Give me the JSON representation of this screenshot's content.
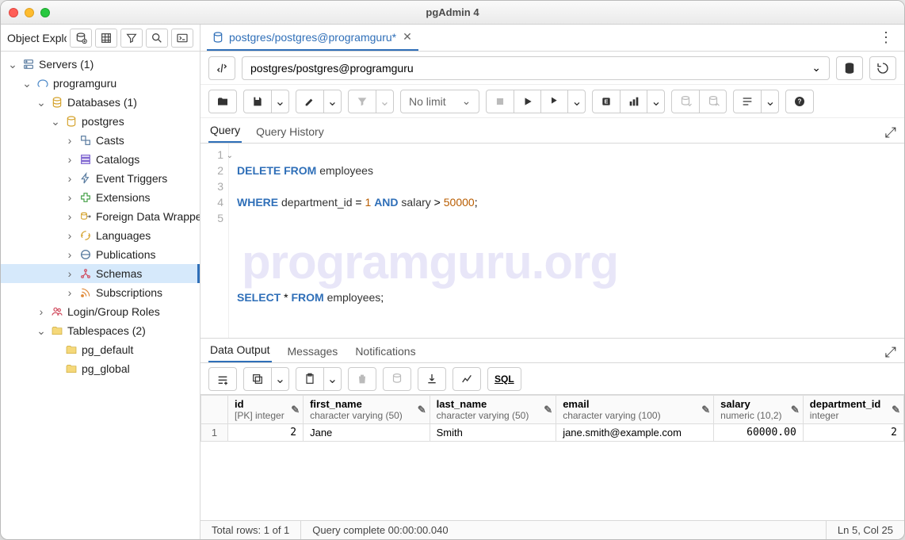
{
  "window": {
    "title": "pgAdmin 4"
  },
  "sidebar": {
    "header": "Object Explorer",
    "tree": {
      "servers": "Servers (1)",
      "server_name": "programguru",
      "databases": "Databases (1)",
      "db_name": "postgres",
      "casts": "Casts",
      "catalogs": "Catalogs",
      "event_triggers": "Event Triggers",
      "extensions": "Extensions",
      "fdw": "Foreign Data Wrappers",
      "languages": "Languages",
      "publications": "Publications",
      "schemas": "Schemas",
      "subscriptions": "Subscriptions",
      "login_roles": "Login/Group Roles",
      "tablespaces": "Tablespaces (2)",
      "ts_default": "pg_default",
      "ts_global": "pg_global"
    }
  },
  "tab": {
    "label": "postgres/postgres@programguru*"
  },
  "connection": {
    "label": "postgres/postgres@programguru"
  },
  "toolbar": {
    "limit": "No limit"
  },
  "editor": {
    "tab_query": "Query",
    "tab_history": "Query History",
    "lines": [
      "1",
      "2",
      "3",
      "4",
      "5"
    ],
    "sql": {
      "l1_kw1": "DELETE",
      "l1_kw2": "FROM",
      "l1_id": "employees",
      "l2_kw1": "WHERE",
      "l2_id1": "department_id",
      "l2_eq": "=",
      "l2_n1": "1",
      "l2_kw2": "AND",
      "l2_id2": "salary",
      "l2_gt": ">",
      "l2_n2": "50000",
      "l2_semi": ";",
      "l5_kw1": "SELECT",
      "l5_star": "*",
      "l5_kw2": "FROM",
      "l5_id": "employees",
      "l5_semi": ";"
    }
  },
  "watermark": "programguru.org",
  "output": {
    "tab_data": "Data Output",
    "tab_messages": "Messages",
    "tab_notifications": "Notifications",
    "sql_label": "SQL",
    "columns": [
      {
        "name": "id",
        "type": "[PK] integer"
      },
      {
        "name": "first_name",
        "type": "character varying (50)"
      },
      {
        "name": "last_name",
        "type": "character varying (50)"
      },
      {
        "name": "email",
        "type": "character varying (100)"
      },
      {
        "name": "salary",
        "type": "numeric (10,2)"
      },
      {
        "name": "department_id",
        "type": "integer"
      }
    ],
    "rows": [
      {
        "n": "1",
        "id": "2",
        "first_name": "Jane",
        "last_name": "Smith",
        "email": "jane.smith@example.com",
        "salary": "60000.00",
        "department_id": "2"
      }
    ]
  },
  "status": {
    "rows": "Total rows: 1 of 1",
    "query": "Query complete 00:00:00.040",
    "cursor": "Ln 5, Col 25"
  }
}
